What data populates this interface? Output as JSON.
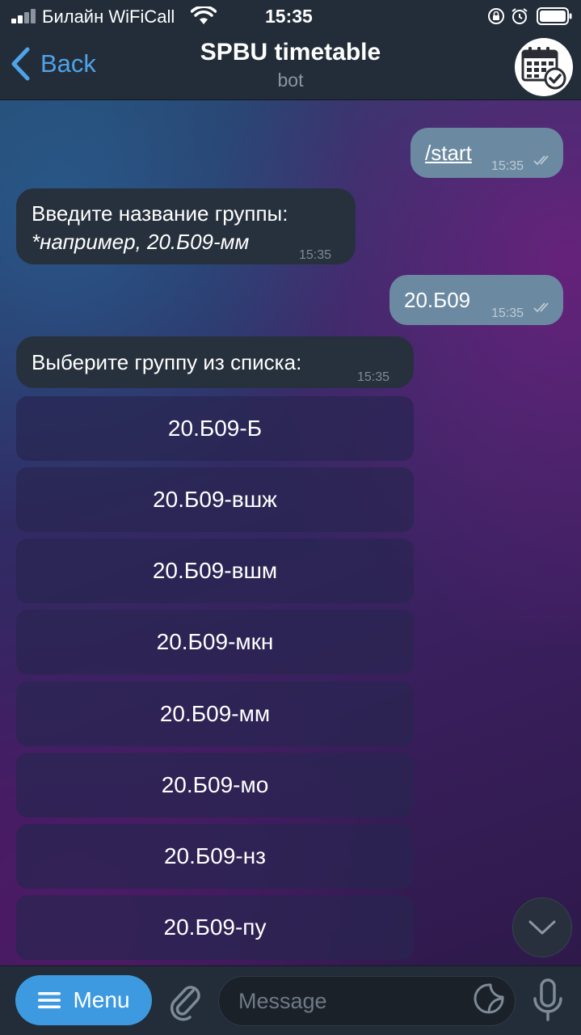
{
  "status_bar": {
    "carrier": "Билайн WiFiCall",
    "time": "15:35",
    "icons": [
      "signal-icon",
      "wifi-icon",
      "rotation-lock-icon",
      "alarm-icon",
      "battery-icon"
    ]
  },
  "header": {
    "back_label": "Back",
    "title": "SPBU timetable",
    "subtitle": "bot",
    "avatar_icon": "calendar-check-icon"
  },
  "messages": [
    {
      "direction": "outgoing",
      "text": "/start",
      "time": "15:35",
      "read": true
    },
    {
      "direction": "incoming",
      "lines": [
        "Введите название группы:",
        "*например, 20.Б09-мм"
      ],
      "time": "15:35"
    },
    {
      "direction": "outgoing",
      "text": "20.Б09",
      "time": "15:35",
      "read": true
    },
    {
      "direction": "incoming",
      "text": "Выберите группу из списка:",
      "time": "15:35"
    }
  ],
  "inline_keyboard": [
    "20.Б09-Б",
    "20.Б09-вшж",
    "20.Б09-вшм",
    "20.Б09-мкн",
    "20.Б09-мм",
    "20.Б09-мо",
    "20.Б09-нз",
    "20.Б09-пу"
  ],
  "bottom_bar": {
    "menu_label": "Menu",
    "input_placeholder": "Message",
    "input_value": ""
  },
  "colors": {
    "accent": "#3e9ae0",
    "link": "#4fa3e8",
    "outgoing_bubble": "#6b8aa1",
    "incoming_bubble": "#27313d",
    "bar_background": "#222d39"
  }
}
